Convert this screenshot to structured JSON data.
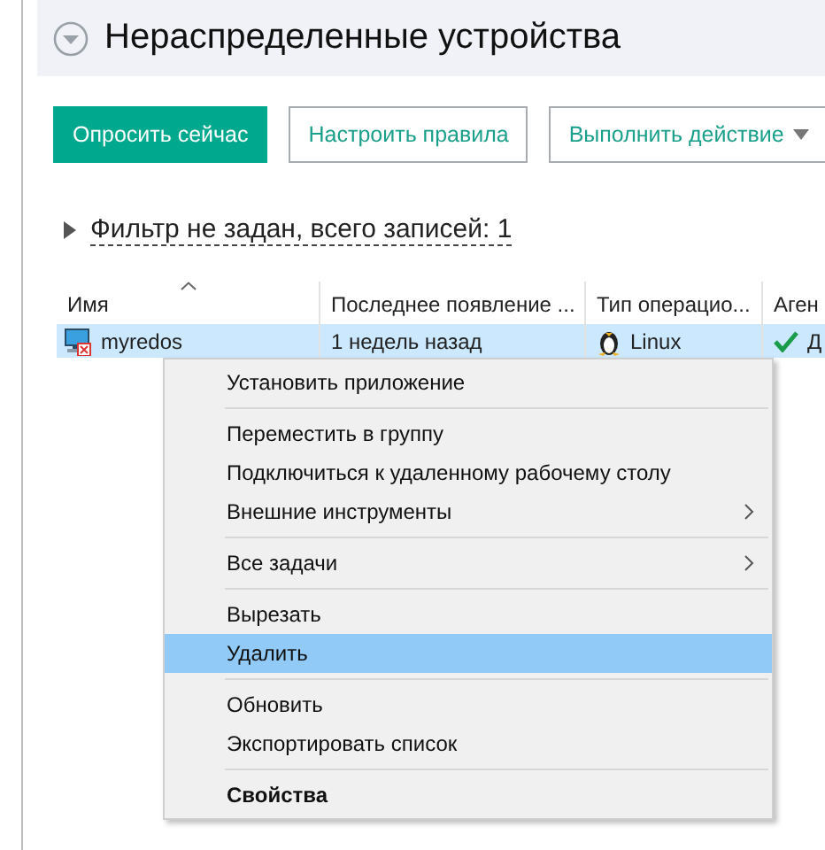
{
  "header": {
    "title": "Нераспределенные устройства"
  },
  "toolbar": [
    {
      "label": "Опросить сейчас",
      "kind": "primary"
    },
    {
      "label": "Настроить правила",
      "kind": "outline"
    },
    {
      "label": "Выполнить действие",
      "kind": "dropdown"
    }
  ],
  "filter": {
    "text": "Фильтр не задан, всего записей: 1",
    "expanded": false
  },
  "table": {
    "columns": [
      {
        "label": "Имя",
        "sorted": true
      },
      {
        "label": "Последнее появление ...",
        "sorted": false
      },
      {
        "label": "Тип операцио...",
        "sorted": false
      },
      {
        "label": "Аген",
        "sorted": false
      }
    ],
    "rows": [
      {
        "selected": true,
        "name": "myredos",
        "last_seen": "1 недель назад",
        "os": "Linux",
        "agent": "Д",
        "agent_ok": true
      }
    ]
  },
  "context_menu": {
    "items": [
      {
        "kind": "item",
        "label": "Установить приложение",
        "submenu": false,
        "selected": false,
        "bold": false
      },
      {
        "kind": "separator"
      },
      {
        "kind": "item",
        "label": "Переместить в группу",
        "submenu": false,
        "selected": false,
        "bold": false
      },
      {
        "kind": "item",
        "label": "Подключиться к удаленному рабочему столу",
        "submenu": false,
        "selected": false,
        "bold": false
      },
      {
        "kind": "item",
        "label": "Внешние инструменты",
        "submenu": true,
        "selected": false,
        "bold": false
      },
      {
        "kind": "separator"
      },
      {
        "kind": "item",
        "label": "Все задачи",
        "submenu": true,
        "selected": false,
        "bold": false
      },
      {
        "kind": "separator"
      },
      {
        "kind": "item",
        "label": "Вырезать",
        "submenu": false,
        "selected": false,
        "bold": false
      },
      {
        "kind": "item",
        "label": "Удалить",
        "submenu": false,
        "selected": true,
        "bold": false
      },
      {
        "kind": "separator"
      },
      {
        "kind": "item",
        "label": "Обновить",
        "submenu": false,
        "selected": false,
        "bold": false
      },
      {
        "kind": "item",
        "label": "Экспортировать список",
        "submenu": false,
        "selected": false,
        "bold": false
      },
      {
        "kind": "separator"
      },
      {
        "kind": "item",
        "label": "Свойства",
        "submenu": false,
        "selected": false,
        "bold": true
      }
    ]
  }
}
